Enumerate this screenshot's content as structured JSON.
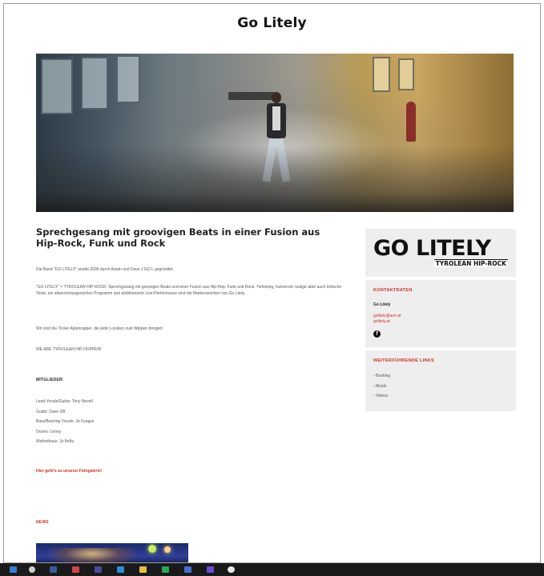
{
  "site": {
    "title": "Go Litely"
  },
  "hero": {
    "alt": "Band header image"
  },
  "main": {
    "heading": "Sprechgesang mit groovigen Beats in einer Fusion aus Hip-Rock, Funk und Rock",
    "paragraphs": [
      "Die Band \"GO LITELY\" wurde 2006 durch Aswin und Dave J GO L gegründet.",
      "\"GO LITELY\" = TYROLEAN HIP-ROCK: Sprechgesang mit groovigen Beats und einer Fusion aus Hip-Hop, Funk und Rock. Tiefsinnig, humorvoll, lustige aber auch kritische Texte, ein abwechslungsreiches Programm und ambitionierte Live-Performance sind die Markenzeichen von Go Litely.",
      "Wir sind die Tiroler Alpenrapper, die jede Location zum Wippen bringen!",
      "WE ARE TYROLEAN HIP-HOPPEN!"
    ],
    "members_title": "MITGLIEDER:",
    "members": [
      "Lead Vocals/Guitar: Tony Nevell",
      "Guitar: Dave DB",
      "Bass/Backing Vocals: Jo Fungus",
      "Drums: Lenny",
      "Weltreihaus: Jo Bella"
    ],
    "recap_link": "Hier geht's zu unserer Fotogalerie!",
    "news_title": "NEWS"
  },
  "sidebar": {
    "logo_text": "GO LITELY",
    "logo_sub": "TYROLEAN HIP-ROCK",
    "contact_title": "KONTAKTDATEN",
    "contact_name": "Go Litely",
    "contact_email": "golitely@aon.at",
    "contact_web": "golitely.at",
    "facebook_icon": "facebook-icon",
    "links_title": "WEITERFÜHRENDE LINKS",
    "links": [
      "› Booking",
      "› Musik",
      "› Videos"
    ]
  },
  "taskbar": {
    "icons": [
      "windows-start-icon",
      "search-icon",
      "file-explorer-icon",
      "app-icon",
      "app-icon",
      "app-icon",
      "app-icon",
      "app-icon",
      "app-icon",
      "app-icon",
      "chrome-icon"
    ]
  }
}
